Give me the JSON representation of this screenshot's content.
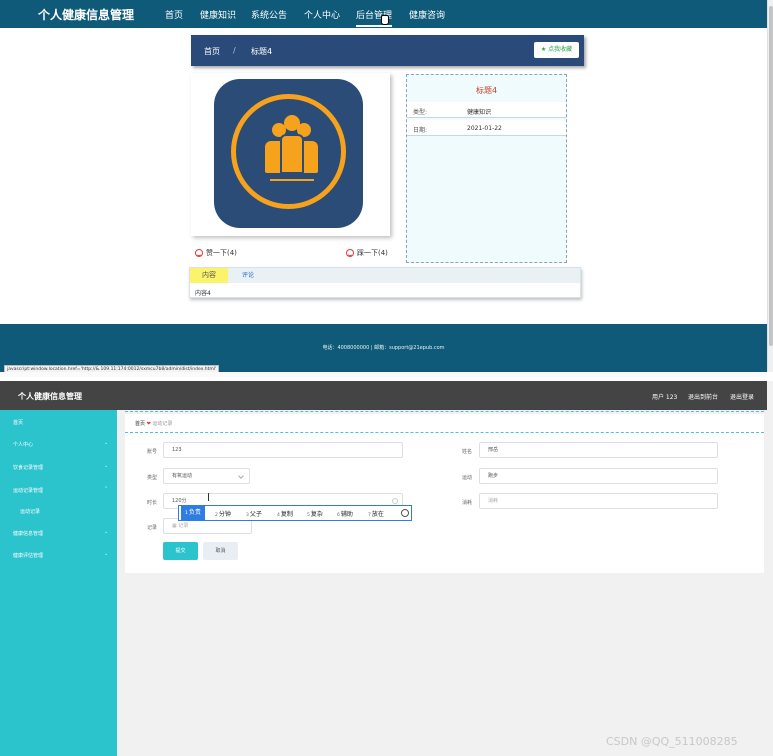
{
  "site": {
    "title": "个人健康信息管理",
    "nav": [
      "首页",
      "健康知识",
      "系统公告",
      "个人中心",
      "后台管理",
      "健康咨询"
    ]
  },
  "detail": {
    "breadcrumb": {
      "home": "首页",
      "separator": "/",
      "current": "标题4"
    },
    "favorite_label": "点我收藏",
    "info": {
      "title": "标题4",
      "rows": [
        {
          "key": "类型:",
          "value": "健康知识"
        },
        {
          "key": "日期:",
          "value": "2021-01-22"
        }
      ]
    },
    "votes": {
      "up": "赞一下(4)",
      "down": "踩一下(4)"
    },
    "tabs": {
      "content": "内容",
      "comment": "评论"
    },
    "content_text": "内容4"
  },
  "footer": {
    "contact": "电话：4008000000 | 邮箱：support@21epub.com"
  },
  "statusbar": "javascript:window.location.href='http://&.109.11:174:0012/sxmcu7b8/admin/dist/index.html'",
  "admin": {
    "title": "个人健康信息管理",
    "user_label": "用户 123",
    "exit_backend": "退出到前台",
    "logout": "退出登录",
    "sidebar": [
      {
        "label": "首页",
        "expandable": false
      },
      {
        "label": "个人中心",
        "expandable": true
      },
      {
        "label": "饮食记录管理",
        "expandable": true
      },
      {
        "label": "运动记录管理",
        "expandable": true
      },
      {
        "label": "运动记录",
        "expandable": false,
        "sub": true
      },
      {
        "label": "健康信息管理",
        "expandable": true
      },
      {
        "label": "健康评估管理",
        "expandable": true
      }
    ],
    "breadcrumb": {
      "home": "首页",
      "current": "运动记录"
    },
    "form": {
      "account": {
        "label": "账号",
        "value": "123"
      },
      "name": {
        "label": "姓名",
        "value": "邢岳"
      },
      "type": {
        "label": "类型",
        "value": "有氧运动"
      },
      "exercise": {
        "label": "运动",
        "value": "跑步"
      },
      "duration": {
        "label": "时长",
        "value": "120分"
      },
      "consumption": {
        "label": "消耗",
        "placeholder": "消耗"
      },
      "record": {
        "label": "记录",
        "placeholder": "记录"
      }
    },
    "ime_candidates": [
      "负责",
      "分钟",
      "父子",
      "复制",
      "复杂",
      "辅助",
      "放在"
    ],
    "submit_label": "提交",
    "cancel_label": "取消"
  },
  "watermark": "CSDN @QQ_511008285"
}
